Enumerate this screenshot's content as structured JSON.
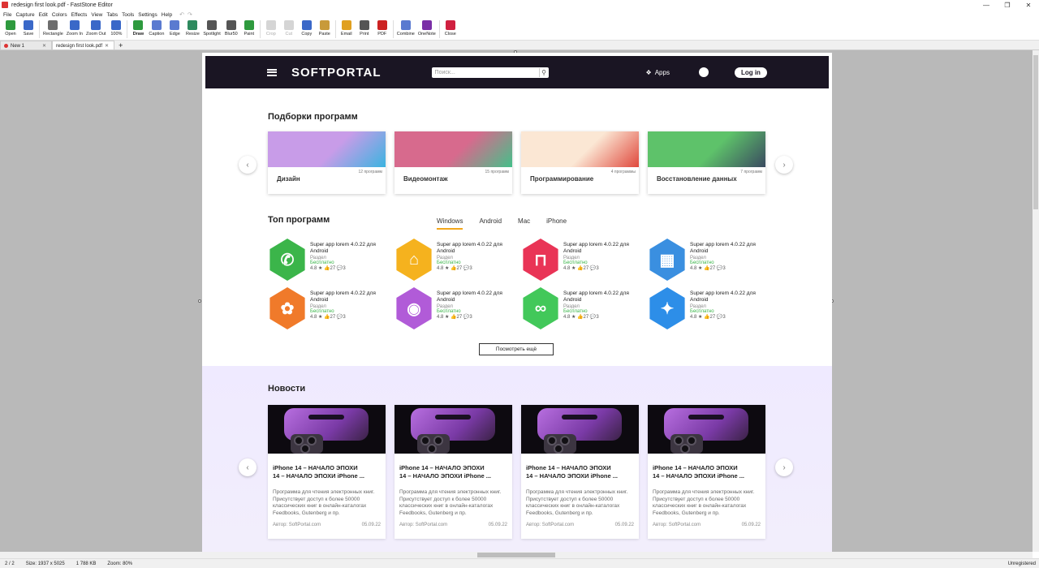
{
  "window": {
    "title": "redesign first look.pdf - FastStone Editor",
    "min_icon": "minimize-icon",
    "max_icon": "maximize-icon",
    "close_icon": "close-icon"
  },
  "menu": [
    "File",
    "Capture",
    "Edit",
    "Colors",
    "Effects",
    "View",
    "Tabs",
    "Tools",
    "Settings",
    "Help"
  ],
  "toolbar": [
    {
      "label": "Open",
      "icon": "open-icon",
      "color": "#2e9a3e",
      "enabled": true
    },
    {
      "label": "Save",
      "icon": "save-icon",
      "color": "#3a68c8",
      "enabled": true
    },
    {
      "label": "Rectangle",
      "icon": "rectangle-select-icon",
      "color": "#6d6d6d",
      "enabled": true
    },
    {
      "label": "Zoom In",
      "icon": "zoom-in-icon",
      "color": "#3a68c8",
      "enabled": true
    },
    {
      "label": "Zoom Out",
      "icon": "zoom-out-icon",
      "color": "#3a68c8",
      "enabled": true
    },
    {
      "label": "100%",
      "icon": "zoom-100-icon",
      "color": "#3a68c8",
      "enabled": true
    },
    {
      "label": "Draw",
      "icon": "draw-icon",
      "color": "#2e9a3e",
      "enabled": true,
      "bold": true
    },
    {
      "label": "Caption",
      "icon": "caption-icon",
      "color": "#5a7ad0",
      "enabled": true
    },
    {
      "label": "Edge",
      "icon": "edge-icon",
      "color": "#5a7ad0",
      "enabled": true
    },
    {
      "label": "Resize",
      "icon": "resize-icon",
      "color": "#2e8a5e",
      "enabled": true
    },
    {
      "label": "Spotlight",
      "icon": "spotlight-icon",
      "color": "#555555",
      "enabled": true
    },
    {
      "label": "Blur50",
      "icon": "blur-icon",
      "color": "#555555",
      "enabled": true
    },
    {
      "label": "Paint",
      "icon": "paint-icon",
      "color": "#2e9a3e",
      "enabled": true
    },
    {
      "label": "Crop",
      "icon": "crop-icon",
      "color": "#888888",
      "enabled": false
    },
    {
      "label": "Cut",
      "icon": "cut-icon",
      "color": "#888888",
      "enabled": false
    },
    {
      "label": "Copy",
      "icon": "copy-icon",
      "color": "#3a68c8",
      "enabled": true
    },
    {
      "label": "Paste",
      "icon": "paste-icon",
      "color": "#c89a3a",
      "enabled": true
    },
    {
      "label": "Email",
      "icon": "email-icon",
      "color": "#e0a020",
      "enabled": true
    },
    {
      "label": "Print",
      "icon": "print-icon",
      "color": "#555555",
      "enabled": true
    },
    {
      "label": "PDF",
      "icon": "pdf-icon",
      "color": "#cc2222",
      "enabled": true
    },
    {
      "label": "Combine",
      "icon": "combine-icon",
      "color": "#5a7ad0",
      "enabled": true
    },
    {
      "label": "OneNote",
      "icon": "onenote-icon",
      "color": "#7a2fa6",
      "enabled": true
    },
    {
      "label": "Close",
      "icon": "close-doc-icon",
      "color": "#d02040",
      "enabled": true
    }
  ],
  "tabs": [
    {
      "label": "New 1",
      "active": false
    },
    {
      "label": "redesign first look.pdf",
      "active": true
    }
  ],
  "tab_add": "+",
  "status": {
    "page": "2 / 2",
    "size": "Size: 1937 x 5025",
    "filesize": "1 788 KB",
    "zoom": "Zoom: 80%",
    "registration": "Unregistered"
  },
  "site": {
    "logo": "SOFTPORTAL",
    "search_placeholder": "Поиск...",
    "apps_label": "Apps",
    "login_label": "Log in",
    "collections_title": "Подборки программ",
    "collections": [
      {
        "name": "Дизайн",
        "count": "12 программ",
        "color": "#c89ce8",
        "accent": "#3bb4e0"
      },
      {
        "name": "Видеомонтаж",
        "count": "15 программ",
        "color": "#d76a8d",
        "accent": "#44c08a"
      },
      {
        "name": "Программирование",
        "count": "4 программы",
        "color": "#fbe7d4",
        "accent": "#e0483c"
      },
      {
        "name": "Восстановление данных",
        "count": "7 программ",
        "color": "#5ec26a",
        "accent": "#3a4a60"
      }
    ],
    "top_title": "Топ программ",
    "platform_tabs": [
      {
        "label": "Windows",
        "active": true
      },
      {
        "label": "Android",
        "active": false
      },
      {
        "label": "Mac",
        "active": false
      },
      {
        "label": "iPhone",
        "active": false
      }
    ],
    "apps": [
      {
        "name": "Super app lorem 4.0.22 для Android",
        "section": "Раздел",
        "price": "Бесплатно",
        "stats": "4.8 ★  👍27  💬3",
        "color": "#3bb54a",
        "icon": "whatsapp-icon",
        "glyph": "✆"
      },
      {
        "name": "Super app lorem 4.0.22 для Android",
        "section": "Раздел",
        "price": "Бесплатно",
        "stats": "4.8 ★  👍27  💬3",
        "color": "#f5b21e",
        "icon": "basket-icon",
        "glyph": "⌂"
      },
      {
        "name": "Super app lorem 4.0.22 для Android",
        "section": "Раздел",
        "price": "Бесплатно",
        "stats": "4.8 ★  👍27  💬3",
        "color": "#e93456",
        "icon": "lock-icon",
        "glyph": "⊓"
      },
      {
        "name": "Super app lorem 4.0.22 для Android",
        "section": "Раздел",
        "price": "Бесплатно",
        "stats": "4.8 ★  👍27  💬3",
        "color": "#3a8fe0",
        "icon": "clapperboard-icon",
        "glyph": "▦"
      },
      {
        "name": "Super app lorem 4.0.22 для Android",
        "section": "Раздел",
        "price": "Бесплатно",
        "stats": "4.8 ★  👍27  💬3",
        "color": "#f07a2a",
        "icon": "photos-icon",
        "glyph": "✿"
      },
      {
        "name": "Super app lorem 4.0.22 для Android",
        "section": "Раздел",
        "price": "Бесплатно",
        "stats": "4.8 ★  👍27  💬3",
        "color": "#b15bd8",
        "icon": "podcasts-icon",
        "glyph": "◉"
      },
      {
        "name": "Super app lorem 4.0.22 для Android",
        "section": "Раздел",
        "price": "Бесплатно",
        "stats": "4.8 ★  👍27  💬3",
        "color": "#42c85a",
        "icon": "link-icon",
        "glyph": "∞"
      },
      {
        "name": "Super app lorem 4.0.22 для Android",
        "section": "Раздел",
        "price": "Бесплатно",
        "stats": "4.8 ★  👍27  💬3",
        "color": "#2d8ee8",
        "icon": "safari-icon",
        "glyph": "✦"
      }
    ],
    "more_label": "Посмотреть ещё",
    "news_title": "Новости",
    "news": [
      {
        "title1": "iPhone 14 – НАЧАЛО ЭПОХИ",
        "title2": "14 – НАЧАЛО ЭПОХИ iPhone ...",
        "desc": "Программа для чтения электронных книг. Присутствует доступ к более 50000 классических книг в онлайн-каталогах Feedbooks, Gutenberg и пр.",
        "author": "Автор: SoftPortal.com",
        "date": "05.09.22"
      },
      {
        "title1": "iPhone 14 – НАЧАЛО ЭПОХИ",
        "title2": "14 – НАЧАЛО ЭПОХИ iPhone ...",
        "desc": "Программа для чтения электронных книг. Присутствует доступ к более 50000 классических книг в онлайн-каталогах Feedbooks, Gutenberg и пр.",
        "author": "Автор: SoftPortal.com",
        "date": "05.09.22"
      },
      {
        "title1": "iPhone 14 – НАЧАЛО ЭПОХИ",
        "title2": "14 – НАЧАЛО ЭПОХИ iPhone ...",
        "desc": "Программа для чтения электронных книг. Присутствует доступ к более 50000 классических книг в онлайн-каталогах Feedbooks, Gutenberg и пр.",
        "author": "Автор: SoftPortal.com",
        "date": "05.09.22"
      },
      {
        "title1": "iPhone 14 – НАЧАЛО ЭПОХИ",
        "title2": "14 – НАЧАЛО ЭПОХИ iPhone ...",
        "desc": "Программа для чтения электронных книг. Присутствует доступ к более 50000 классических книг в онлайн-каталогах Feedbooks, Gutenberg и пр.",
        "author": "Автор: SoftPortal.com",
        "date": "05.09.22"
      }
    ]
  }
}
